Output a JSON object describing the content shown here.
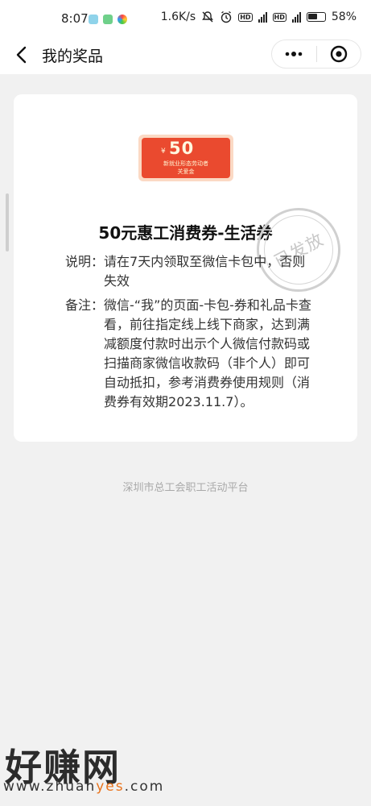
{
  "status_bar": {
    "time": "8:07",
    "net_speed": "1.6K/s",
    "hd1": "HD",
    "hd2": "HD",
    "battery": "58%"
  },
  "nav": {
    "title": "我的奖品",
    "back_icon": "chevron-left-icon",
    "more_icon": "more-dots-icon",
    "close_icon": "target-close-icon"
  },
  "coupon": {
    "currency": "¥",
    "amount": "50",
    "line1": "新就业形态劳动者",
    "line2": "关爱金"
  },
  "prize": {
    "title": "50元惠工消费券-生活券",
    "stamp": "已发放",
    "desc_label": "说明：",
    "desc_text": "请在7天内领取至微信卡包中，否则失效",
    "note_label": "备注：",
    "note_text": "微信-“我”的页面-卡包-券和礼品卡查看，前往指定线上线下商家，达到满减额度付款时出示个人微信付款码或扫描商家微信收款码（非个人）即可自动抵扣，参考消费券使用规则（消费券有效期2023.11.7）。"
  },
  "footer": "深圳市总工会职工活动平台",
  "watermark": {
    "logo": "好赚网",
    "url_prefix": "www.zhuan",
    "url_accent": "yes",
    "url_suffix": ".com"
  },
  "colors": {
    "coupon_red": "#ea4a2f",
    "coupon_border": "#fbd9c4",
    "page_bg": "#f1f1f1",
    "stamp_gray": "#c8c8c8",
    "accent_orange": "#e9731c"
  }
}
